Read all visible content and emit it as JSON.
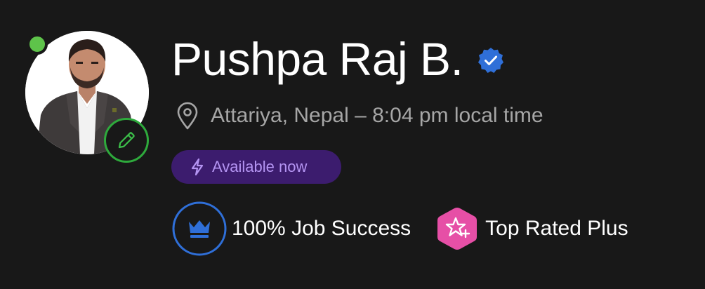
{
  "profile": {
    "name": "Pushpa Raj B.",
    "location": "Attariya, Nepal – 8:04 pm local time",
    "availability": "Available now",
    "job_success": "100% Job Success",
    "top_rated": "Top Rated Plus"
  },
  "icons": {
    "verified": "verified-badge-icon",
    "location": "location-pin-icon",
    "availability": "lightning-bolt-icon",
    "edit": "pencil-icon",
    "job_success": "crown-icon",
    "top_rated": "star-plus-icon"
  },
  "colors": {
    "background": "#181818",
    "online": "#5ec34a",
    "edit_ring": "#2eaa3c",
    "verified": "#2f6fd8",
    "availability_bg": "#3c1c6e",
    "availability_text": "#b494f2",
    "job_success_ring": "#2f6fd8",
    "top_rated_badge": "#e64fa6",
    "muted_text": "#a6a6a6"
  }
}
